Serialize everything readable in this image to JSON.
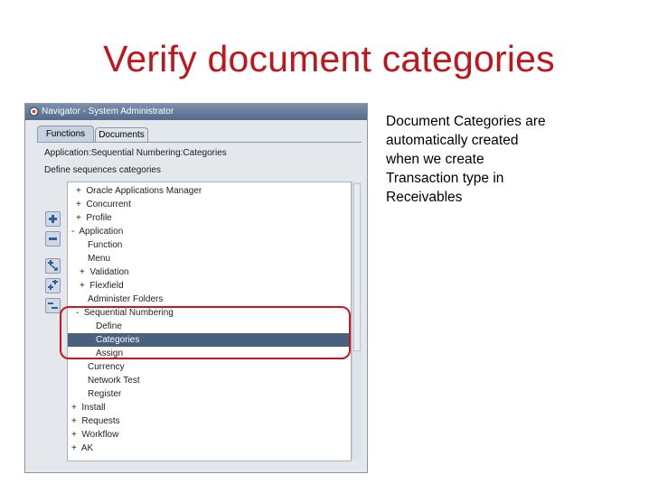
{
  "slide": {
    "title": "Verify document categories",
    "description_lines": [
      "Document Categories are",
      "automatically created",
      "when we create",
      "Transaction type in",
      "Receivables"
    ]
  },
  "window": {
    "title": "Navigator - System Administrator",
    "tabs": [
      {
        "label": "Functions",
        "active": true
      },
      {
        "label": "Documents",
        "active": false
      }
    ],
    "application_path": "Application:Sequential Numbering:Categories",
    "instruction": "Define sequences categories"
  },
  "tree": {
    "items": [
      {
        "label": "+  Oracle Applications Manager",
        "selected": false
      },
      {
        "label": "+  Concurrent",
        "selected": false
      },
      {
        "label": "+  Profile",
        "selected": false
      },
      {
        "label": "-  Application",
        "selected": false
      },
      {
        "label": "Function",
        "selected": false
      },
      {
        "label": "Menu",
        "selected": false
      },
      {
        "label": "+  Validation",
        "selected": false
      },
      {
        "label": "+  Flexfield",
        "selected": false
      },
      {
        "label": "Administer Folders",
        "selected": false
      },
      {
        "label": "-  Sequential Numbering",
        "selected": false
      },
      {
        "label": "Define",
        "selected": false
      },
      {
        "label": "Categories",
        "selected": true
      },
      {
        "label": "Assign",
        "selected": false
      },
      {
        "label": "Currency",
        "selected": false
      },
      {
        "label": "Network Test",
        "selected": false
      },
      {
        "label": "Register",
        "selected": false
      },
      {
        "label": "+  Install",
        "selected": false
      },
      {
        "label": "+  Requests",
        "selected": false
      },
      {
        "label": "+  Workflow",
        "selected": false
      },
      {
        "label": "+  AK",
        "selected": false
      }
    ]
  },
  "toolbar": [
    {
      "icon": "expand-icon"
    },
    {
      "icon": "collapse-icon"
    },
    {
      "icon": "expand-branch-icon"
    },
    {
      "icon": "expand-all-icon"
    },
    {
      "icon": "collapse-all-icon"
    }
  ],
  "colors": {
    "title": "#c0151b",
    "selected_row": "#4a607f",
    "highlight_box": "#d0131e"
  }
}
